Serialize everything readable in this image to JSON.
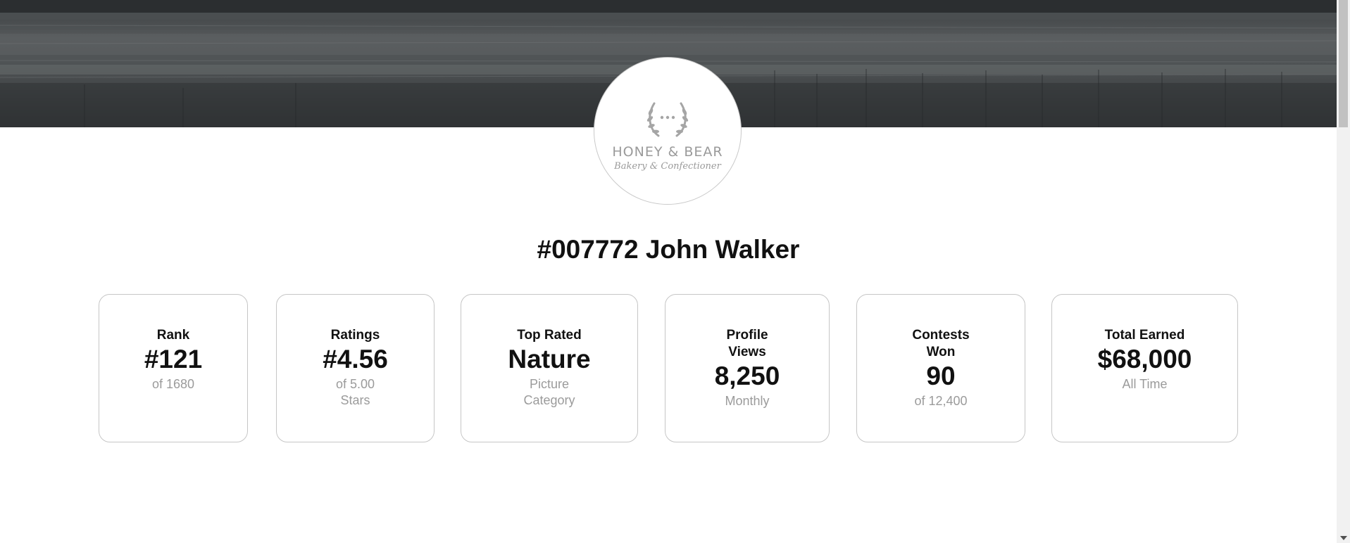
{
  "logo": {
    "name": "HONEY & BEAR",
    "tagline": "Bakery & Confectioner"
  },
  "profile": {
    "title": "#007772 John Walker"
  },
  "stats": [
    {
      "label": "Rank",
      "value": "#121",
      "sub": "of 1680"
    },
    {
      "label": "Ratings",
      "value": "#4.56",
      "sub": "of 5.00 Stars"
    },
    {
      "label": "Top Rated",
      "value": "Nature",
      "sub": "Picture Category"
    },
    {
      "label": "Profile Views",
      "value": "8,250",
      "sub": "Monthly"
    },
    {
      "label": "Contests Won",
      "value": "90",
      "sub": "of 12,400"
    },
    {
      "label": "Total Earned",
      "value": "$68,000",
      "sub": "All Time"
    }
  ],
  "colors": {
    "text": "#111111",
    "muted": "#9b9b9b",
    "card_border": "#c6c6c6",
    "hero": "#4d5153"
  }
}
